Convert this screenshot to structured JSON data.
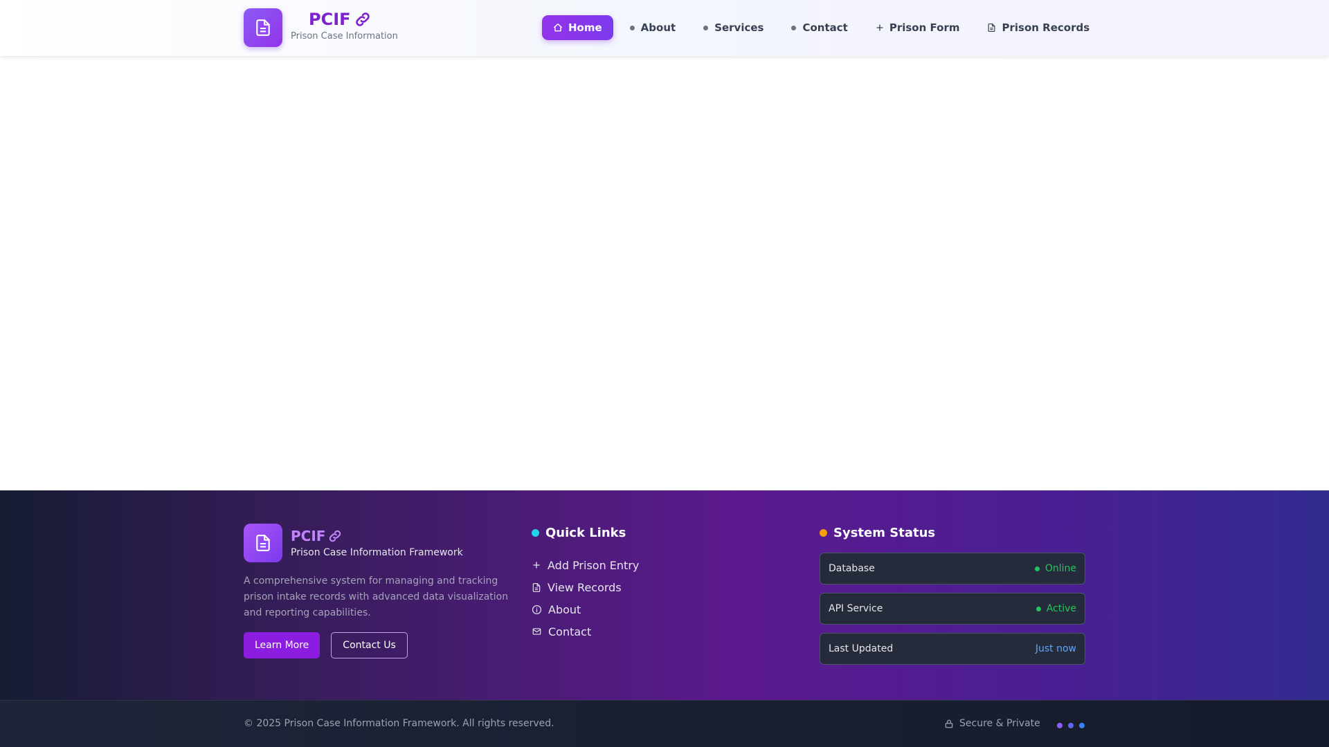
{
  "header": {
    "brand_title": "PCIF",
    "brand_subtitle": "Prison Case Information",
    "nav": [
      {
        "label": "Home",
        "icon": "home-icon",
        "active": true
      },
      {
        "label": "About",
        "icon": "dot"
      },
      {
        "label": "Services",
        "icon": "dot"
      },
      {
        "label": "Contact",
        "icon": "dot"
      },
      {
        "label": "Prison Form",
        "icon": "plus-icon"
      },
      {
        "label": "Prison Records",
        "icon": "document-icon"
      }
    ]
  },
  "footer": {
    "brand_title": "PCIF",
    "brand_subtitle": "Prison Case Information Framework",
    "description": "A comprehensive system for managing and tracking prison intake records with advanced data visualization and reporting capabilities.",
    "buttons": {
      "primary": "Learn More",
      "secondary": "Contact Us"
    },
    "quick_links": {
      "heading": "Quick Links",
      "items": [
        {
          "label": "Add Prison Entry",
          "icon": "plus-icon"
        },
        {
          "label": "View Records",
          "icon": "document-icon"
        },
        {
          "label": "About",
          "icon": "info-icon"
        },
        {
          "label": "Contact",
          "icon": "mail-icon"
        }
      ]
    },
    "system_status": {
      "heading": "System Status",
      "rows": [
        {
          "label": "Database",
          "value": "Online"
        },
        {
          "label": "API Service",
          "value": "Active"
        },
        {
          "label": "Last Updated",
          "value": "Just now"
        }
      ]
    },
    "copyright": "© 2025 Prison Case Information Framework. All rights reserved.",
    "secure_label": "Secure & Private"
  },
  "colors": {
    "accent": "#9333ea",
    "status_ok": "#22c55e",
    "status_info": "#60a5fa",
    "quick_links_dot": "#22d3ee",
    "system_status_dot": "#f59e0b"
  }
}
